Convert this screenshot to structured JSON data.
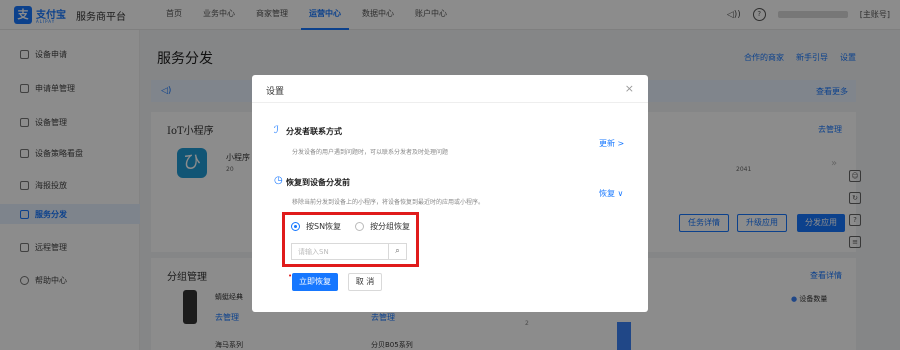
{
  "header": {
    "logo_glyph": "支",
    "logo_text": "支付宝",
    "logo_sub": "ALIPAY",
    "platform": "服务商平台",
    "nav": [
      "首页",
      "业务中心",
      "商家管理",
      "运营中心",
      "数据中心",
      "账户中心"
    ],
    "active_nav": "运营中心",
    "account": "[主账号]"
  },
  "sidebar": {
    "items": [
      {
        "label": "设备申请",
        "icon": "device-apply-icon"
      },
      {
        "label": "申请单管理",
        "icon": "order-manage-icon"
      },
      {
        "label": "设备管理",
        "icon": "device-manage-icon"
      },
      {
        "label": "设备策略看盘",
        "icon": "strategy-board-icon"
      },
      {
        "label": "海报投放",
        "icon": "poster-icon"
      },
      {
        "label": "服务分发",
        "icon": "grid-icon",
        "active": true
      },
      {
        "label": "远程管理",
        "icon": "remote-icon"
      },
      {
        "label": "帮助中心",
        "icon": "help-icon"
      }
    ]
  },
  "main": {
    "title": "服务分发",
    "links": [
      "合作的商家",
      "新手引导",
      "设置"
    ],
    "notice_more": "查看更多",
    "iot_card": {
      "title": "IoT小程序",
      "manage": "去管理",
      "app_name": "小程序",
      "app_meta": "20",
      "right_meta": "2041",
      "buttons": [
        "任务详情",
        "升级应用",
        "分发应用"
      ]
    },
    "group_card": {
      "title": "分组管理",
      "view_detail": "查看详情",
      "manage1": "去管理",
      "manage2": "去管理",
      "legend": "设备数量",
      "item1": "蜻蜓经典",
      "item2": "海马系列",
      "item3": "分贝B05系列",
      "axis_tick": "2"
    }
  },
  "modal": {
    "title": "设置",
    "close": "×",
    "sections": [
      {
        "title": "分发者联系方式",
        "desc": "分发设备的用户遇到问题时，可以联系分发者及时处理问题",
        "action": "更新 >"
      },
      {
        "title": "恢复到设备分发前",
        "desc": "移除当前分发到设备上的小程序，将设备恢复到最近时的应用或小程序。",
        "action": "恢复 ∨"
      }
    ],
    "radio_sn": "按SN恢复",
    "radio_group": "按分组恢复",
    "search_placeholder": "请输入SN",
    "restore_button": "立即恢复",
    "cancel_button": "取 消"
  },
  "colors": {
    "accent": "#1677ff",
    "highlight": "#e01b1b"
  }
}
